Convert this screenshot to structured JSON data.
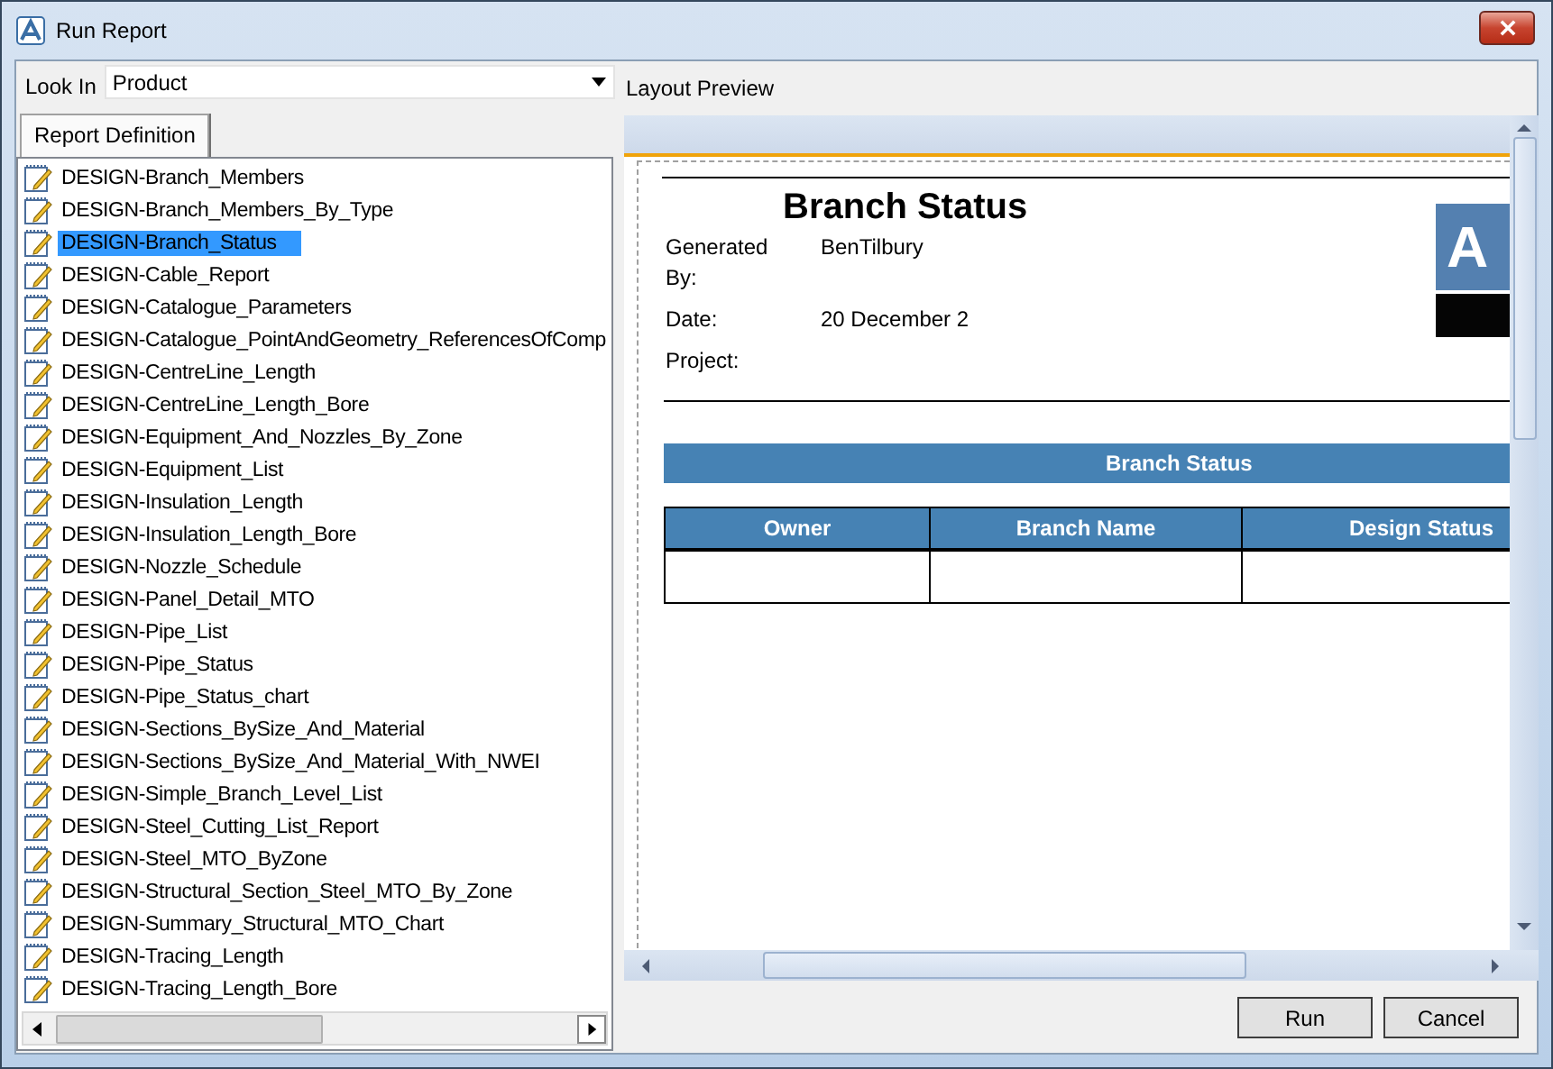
{
  "window": {
    "title": "Run Report"
  },
  "look_in": {
    "label": "Look In",
    "value": "Product"
  },
  "tabs": [
    {
      "label": "Report Definition",
      "selected": true
    }
  ],
  "reports": [
    {
      "name": "DESIGN-Branch_Members",
      "selected": false
    },
    {
      "name": "DESIGN-Branch_Members_By_Type",
      "selected": false
    },
    {
      "name": "DESIGN-Branch_Status",
      "selected": true
    },
    {
      "name": "DESIGN-Cable_Report",
      "selected": false
    },
    {
      "name": "DESIGN-Catalogue_Parameters",
      "selected": false
    },
    {
      "name": "DESIGN-Catalogue_PointAndGeometry_ReferencesOfComp",
      "selected": false
    },
    {
      "name": "DESIGN-CentreLine_Length",
      "selected": false
    },
    {
      "name": "DESIGN-CentreLine_Length_Bore",
      "selected": false
    },
    {
      "name": "DESIGN-Equipment_And_Nozzles_By_Zone",
      "selected": false
    },
    {
      "name": "DESIGN-Equipment_List",
      "selected": false
    },
    {
      "name": "DESIGN-Insulation_Length",
      "selected": false
    },
    {
      "name": "DESIGN-Insulation_Length_Bore",
      "selected": false
    },
    {
      "name": "DESIGN-Nozzle_Schedule",
      "selected": false
    },
    {
      "name": "DESIGN-Panel_Detail_MTO",
      "selected": false
    },
    {
      "name": "DESIGN-Pipe_List",
      "selected": false
    },
    {
      "name": "DESIGN-Pipe_Status",
      "selected": false
    },
    {
      "name": "DESIGN-Pipe_Status_chart",
      "selected": false
    },
    {
      "name": "DESIGN-Sections_BySize_And_Material",
      "selected": false
    },
    {
      "name": "DESIGN-Sections_BySize_And_Material_With_NWEI",
      "selected": false
    },
    {
      "name": "DESIGN-Simple_Branch_Level_List",
      "selected": false
    },
    {
      "name": "DESIGN-Steel_Cutting_List_Report",
      "selected": false
    },
    {
      "name": "DESIGN-Steel_MTO_ByZone",
      "selected": false
    },
    {
      "name": "DESIGN-Structural_Section_Steel_MTO_By_Zone",
      "selected": false
    },
    {
      "name": "DESIGN-Summary_Structural_MTO_Chart",
      "selected": false
    },
    {
      "name": "DESIGN-Tracing_Length",
      "selected": false
    },
    {
      "name": "DESIGN-Tracing_Length_Bore",
      "selected": false
    }
  ],
  "preview": {
    "label": "Layout Preview",
    "report": {
      "title": "Branch Status",
      "fields": [
        {
          "label": "Generated By:",
          "value": "BenTilbury"
        },
        {
          "label": "Date:",
          "value": "20 December 2"
        },
        {
          "label": "Project:"
        }
      ],
      "logo_text": "A",
      "band_title": "Branch Status",
      "columns": [
        "Owner",
        "Branch Name",
        "Design Status"
      ]
    }
  },
  "buttons": [
    {
      "label": "Run"
    },
    {
      "label": "Cancel"
    }
  ]
}
